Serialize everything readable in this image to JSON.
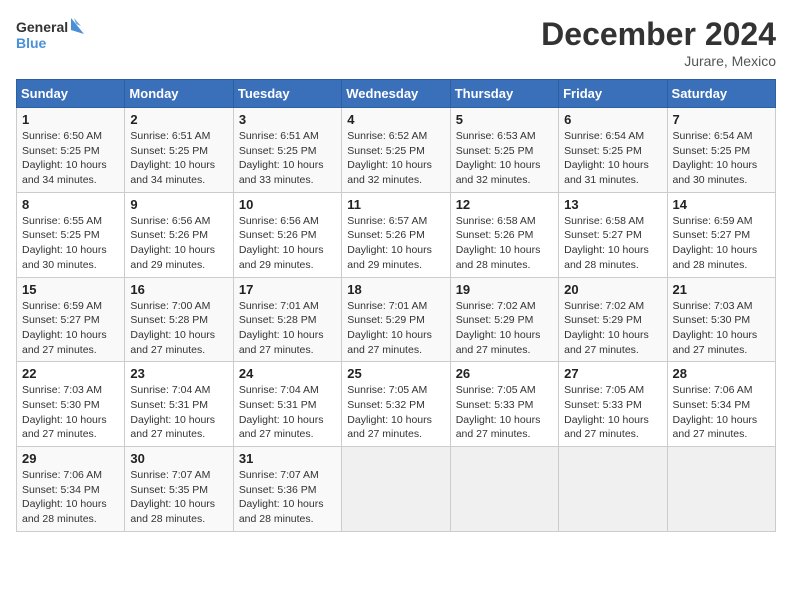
{
  "logo": {
    "line1": "General",
    "line2": "Blue"
  },
  "title": "December 2024",
  "subtitle": "Jurare, Mexico",
  "weekdays": [
    "Sunday",
    "Monday",
    "Tuesday",
    "Wednesday",
    "Thursday",
    "Friday",
    "Saturday"
  ],
  "weeks": [
    [
      {
        "day": "1",
        "info": "Sunrise: 6:50 AM\nSunset: 5:25 PM\nDaylight: 10 hours\nand 34 minutes."
      },
      {
        "day": "2",
        "info": "Sunrise: 6:51 AM\nSunset: 5:25 PM\nDaylight: 10 hours\nand 34 minutes."
      },
      {
        "day": "3",
        "info": "Sunrise: 6:51 AM\nSunset: 5:25 PM\nDaylight: 10 hours\nand 33 minutes."
      },
      {
        "day": "4",
        "info": "Sunrise: 6:52 AM\nSunset: 5:25 PM\nDaylight: 10 hours\nand 32 minutes."
      },
      {
        "day": "5",
        "info": "Sunrise: 6:53 AM\nSunset: 5:25 PM\nDaylight: 10 hours\nand 32 minutes."
      },
      {
        "day": "6",
        "info": "Sunrise: 6:54 AM\nSunset: 5:25 PM\nDaylight: 10 hours\nand 31 minutes."
      },
      {
        "day": "7",
        "info": "Sunrise: 6:54 AM\nSunset: 5:25 PM\nDaylight: 10 hours\nand 30 minutes."
      }
    ],
    [
      {
        "day": "8",
        "info": "Sunrise: 6:55 AM\nSunset: 5:25 PM\nDaylight: 10 hours\nand 30 minutes."
      },
      {
        "day": "9",
        "info": "Sunrise: 6:56 AM\nSunset: 5:26 PM\nDaylight: 10 hours\nand 29 minutes."
      },
      {
        "day": "10",
        "info": "Sunrise: 6:56 AM\nSunset: 5:26 PM\nDaylight: 10 hours\nand 29 minutes."
      },
      {
        "day": "11",
        "info": "Sunrise: 6:57 AM\nSunset: 5:26 PM\nDaylight: 10 hours\nand 29 minutes."
      },
      {
        "day": "12",
        "info": "Sunrise: 6:58 AM\nSunset: 5:26 PM\nDaylight: 10 hours\nand 28 minutes."
      },
      {
        "day": "13",
        "info": "Sunrise: 6:58 AM\nSunset: 5:27 PM\nDaylight: 10 hours\nand 28 minutes."
      },
      {
        "day": "14",
        "info": "Sunrise: 6:59 AM\nSunset: 5:27 PM\nDaylight: 10 hours\nand 28 minutes."
      }
    ],
    [
      {
        "day": "15",
        "info": "Sunrise: 6:59 AM\nSunset: 5:27 PM\nDaylight: 10 hours\nand 27 minutes."
      },
      {
        "day": "16",
        "info": "Sunrise: 7:00 AM\nSunset: 5:28 PM\nDaylight: 10 hours\nand 27 minutes."
      },
      {
        "day": "17",
        "info": "Sunrise: 7:01 AM\nSunset: 5:28 PM\nDaylight: 10 hours\nand 27 minutes."
      },
      {
        "day": "18",
        "info": "Sunrise: 7:01 AM\nSunset: 5:29 PM\nDaylight: 10 hours\nand 27 minutes."
      },
      {
        "day": "19",
        "info": "Sunrise: 7:02 AM\nSunset: 5:29 PM\nDaylight: 10 hours\nand 27 minutes."
      },
      {
        "day": "20",
        "info": "Sunrise: 7:02 AM\nSunset: 5:29 PM\nDaylight: 10 hours\nand 27 minutes."
      },
      {
        "day": "21",
        "info": "Sunrise: 7:03 AM\nSunset: 5:30 PM\nDaylight: 10 hours\nand 27 minutes."
      }
    ],
    [
      {
        "day": "22",
        "info": "Sunrise: 7:03 AM\nSunset: 5:30 PM\nDaylight: 10 hours\nand 27 minutes."
      },
      {
        "day": "23",
        "info": "Sunrise: 7:04 AM\nSunset: 5:31 PM\nDaylight: 10 hours\nand 27 minutes."
      },
      {
        "day": "24",
        "info": "Sunrise: 7:04 AM\nSunset: 5:31 PM\nDaylight: 10 hours\nand 27 minutes."
      },
      {
        "day": "25",
        "info": "Sunrise: 7:05 AM\nSunset: 5:32 PM\nDaylight: 10 hours\nand 27 minutes."
      },
      {
        "day": "26",
        "info": "Sunrise: 7:05 AM\nSunset: 5:33 PM\nDaylight: 10 hours\nand 27 minutes."
      },
      {
        "day": "27",
        "info": "Sunrise: 7:05 AM\nSunset: 5:33 PM\nDaylight: 10 hours\nand 27 minutes."
      },
      {
        "day": "28",
        "info": "Sunrise: 7:06 AM\nSunset: 5:34 PM\nDaylight: 10 hours\nand 27 minutes."
      }
    ],
    [
      {
        "day": "29",
        "info": "Sunrise: 7:06 AM\nSunset: 5:34 PM\nDaylight: 10 hours\nand 28 minutes."
      },
      {
        "day": "30",
        "info": "Sunrise: 7:07 AM\nSunset: 5:35 PM\nDaylight: 10 hours\nand 28 minutes."
      },
      {
        "day": "31",
        "info": "Sunrise: 7:07 AM\nSunset: 5:36 PM\nDaylight: 10 hours\nand 28 minutes."
      },
      {
        "day": "",
        "info": ""
      },
      {
        "day": "",
        "info": ""
      },
      {
        "day": "",
        "info": ""
      },
      {
        "day": "",
        "info": ""
      }
    ]
  ]
}
